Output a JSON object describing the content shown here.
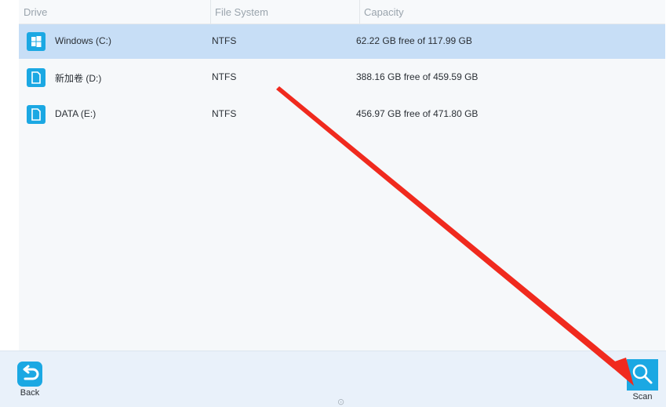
{
  "table": {
    "headers": {
      "drive": "Drive",
      "fs": "File System",
      "capacity": "Capacity"
    },
    "rows": [
      {
        "name": "Windows (C:)",
        "fs": "NTFS",
        "capacity": "62.22 GB free of 117.99 GB",
        "icon": "windows-drive-icon",
        "selected": true
      },
      {
        "name": "新加卷 (D:)",
        "fs": "NTFS",
        "capacity": "388.16 GB free of 459.59 GB",
        "icon": "drive-icon",
        "selected": false
      },
      {
        "name": "DATA (E:)",
        "fs": "NTFS",
        "capacity": "456.97 GB free of 471.80 GB",
        "icon": "drive-icon",
        "selected": false
      }
    ]
  },
  "footer": {
    "back_label": "Back",
    "scan_label": "Scan"
  },
  "colors": {
    "accent": "#1ba8e3",
    "selected_row": "#c7def6",
    "annotation_arrow": "#f02a1e"
  }
}
